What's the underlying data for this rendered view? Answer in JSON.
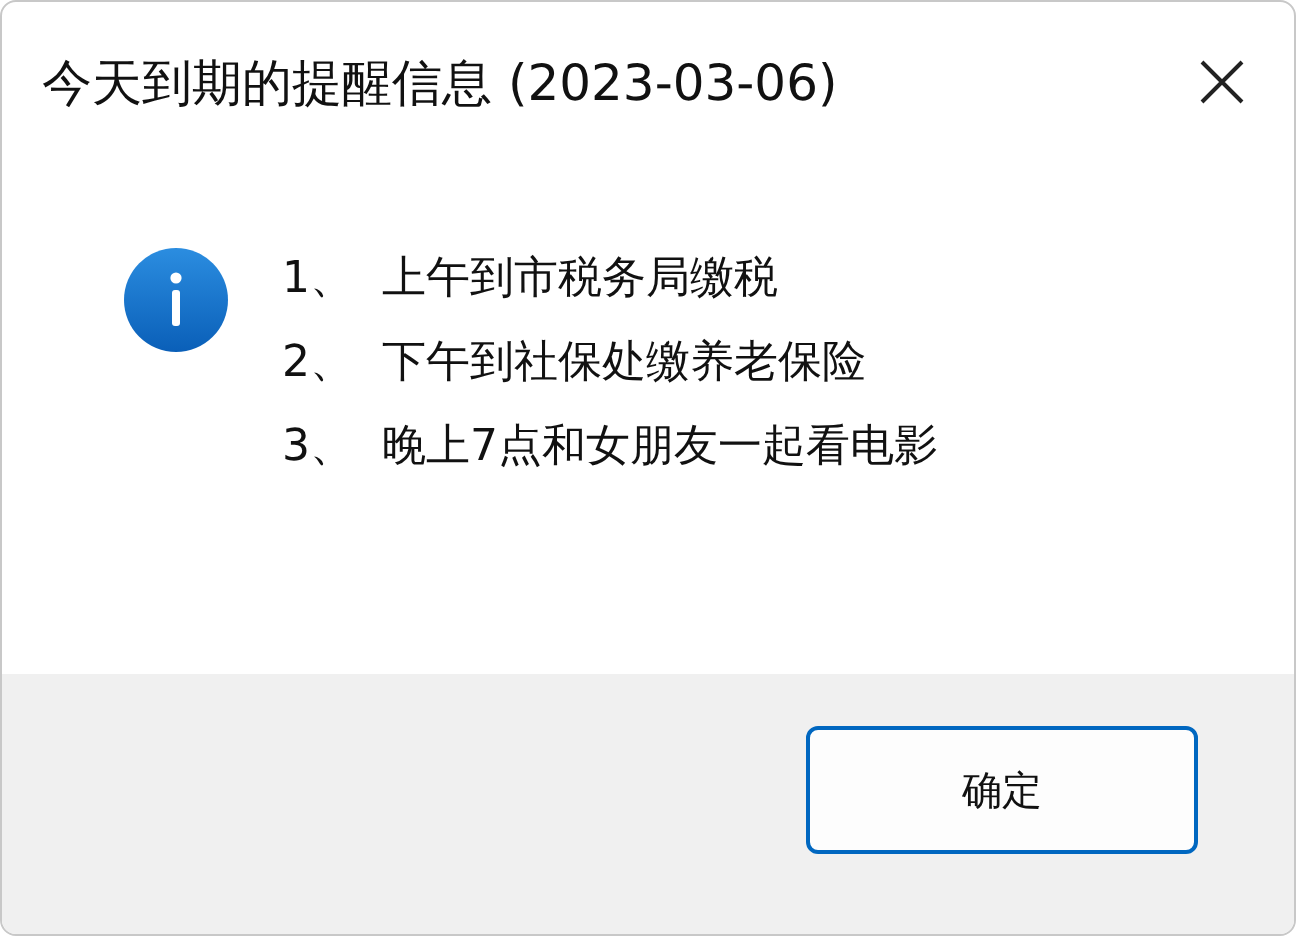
{
  "window": {
    "title": "今天到期的提醒信息 (2023-03-06)"
  },
  "messages": [
    {
      "number": "1、",
      "text": "上午到市税务局缴税"
    },
    {
      "number": "2、",
      "text": "下午到社保处缴养老保险"
    },
    {
      "number": "3、",
      "text": "晚上7点和女朋友一起看电影"
    }
  ],
  "buttons": [
    {
      "label": "确定",
      "default": true
    }
  ]
}
